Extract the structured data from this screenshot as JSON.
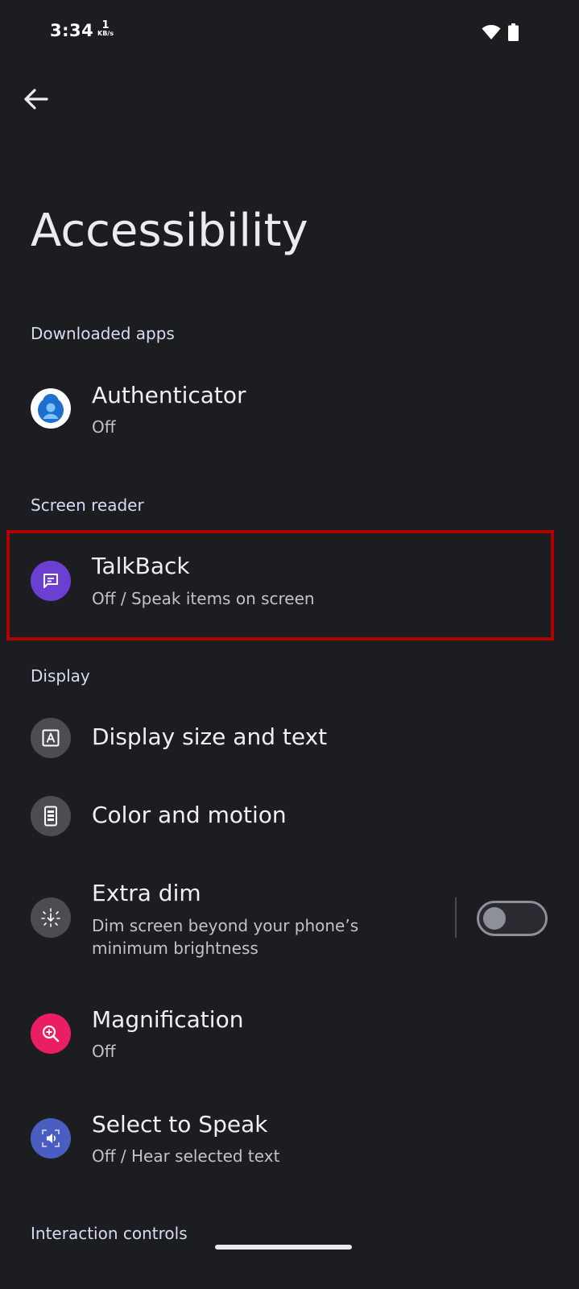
{
  "status_bar": {
    "time": "3:34",
    "net_speed_value": "1",
    "net_speed_unit": "KB/s",
    "icons": [
      "wifi-icon",
      "battery-icon"
    ]
  },
  "header": {
    "back_icon": "arrow-left-icon",
    "title": "Accessibility"
  },
  "sections": {
    "downloaded_apps": "Downloaded apps",
    "screen_reader": "Screen reader",
    "display": "Display",
    "interaction_controls": "Interaction controls"
  },
  "items": {
    "authenticator": {
      "title": "Authenticator",
      "subtitle": "Off",
      "icon": "authenticator-app-icon"
    },
    "talkback": {
      "title": "TalkBack",
      "subtitle": "Off / Speak items on screen",
      "icon": "talkback-icon"
    },
    "display_size": {
      "title": "Display size and text",
      "icon": "text-size-icon"
    },
    "color_motion": {
      "title": "Color and motion",
      "icon": "phone-display-icon"
    },
    "extra_dim": {
      "title": "Extra dim",
      "subtitle": "Dim screen beyond your phone’s minimum brightness",
      "icon": "extra-dim-icon",
      "toggle_on": false
    },
    "magnification": {
      "title": "Magnification",
      "subtitle": "Off",
      "icon": "magnify-icon"
    },
    "select_to_speak": {
      "title": "Select to Speak",
      "subtitle": "Off / Hear selected text",
      "icon": "select-to-speak-icon"
    }
  },
  "colors": {
    "background": "#1c1d21",
    "highlight_border": "#b00000",
    "talkback_icon_bg": "#6b3fd1",
    "magnification_icon_bg": "#ea1e63",
    "select_to_speak_icon_bg": "#4a5ec2",
    "neutral_icon_bg": "#4c4d52"
  }
}
